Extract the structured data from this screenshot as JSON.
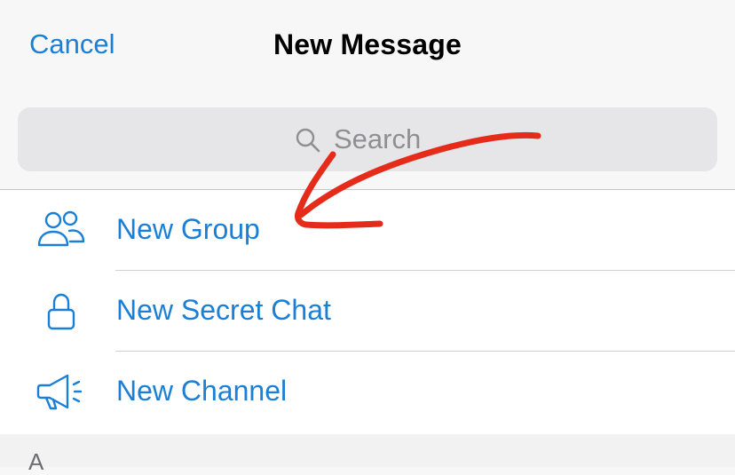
{
  "header": {
    "cancel_label": "Cancel",
    "title": "New Message"
  },
  "search": {
    "placeholder": "Search",
    "icon": "search-icon"
  },
  "actions": [
    {
      "label": "New Group",
      "icon": "group-icon"
    },
    {
      "label": "New Secret Chat",
      "icon": "lock-icon"
    },
    {
      "label": "New Channel",
      "icon": "megaphone-icon"
    }
  ],
  "section": {
    "letter": "A"
  },
  "colors": {
    "accent": "#1a7fd6",
    "annotation": "#e52b1a",
    "header_bg": "#f7f7f7",
    "search_bg": "#e6e6e8"
  }
}
